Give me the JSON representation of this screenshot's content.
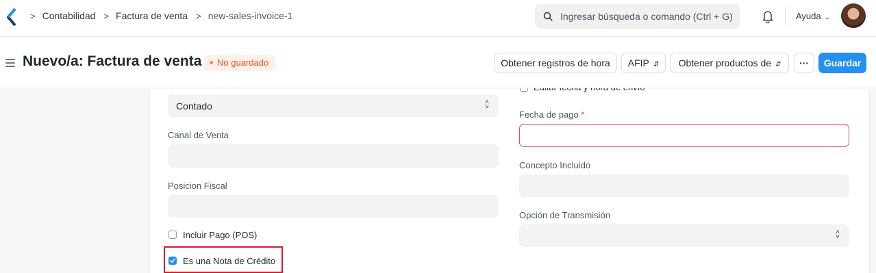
{
  "navbar": {
    "breadcrumbs": [
      "Contabilidad",
      "Factura de venta",
      "new-sales-invoice-1"
    ],
    "search_placeholder": "Ingresar búsqueda o comando (Ctrl + G)",
    "help_label": "Ayuda"
  },
  "page_header": {
    "title": "Nuevo/a: Factura de venta",
    "status": "No guardado",
    "buttons": {
      "time_logs": "Obtener registros de hora",
      "afip": "AFIP",
      "get_items": "Obtener productos de",
      "more": "···",
      "save": "Guardar"
    }
  },
  "form": {
    "left": {
      "payment_type_value": "Contado",
      "sales_channel_label": "Canal de Venta",
      "sales_channel_value": "",
      "fiscal_position_label": "Posicion Fiscal",
      "fiscal_position_value": "",
      "include_payment_label": "Incluir Pago (POS)",
      "include_payment_checked": false,
      "credit_note_label": "Es una Nota de Crédito",
      "credit_note_checked": true
    },
    "right": {
      "edit_datetime_label": "Editar fecha y hora de envío",
      "edit_datetime_checked": false,
      "due_date_label": "Fecha de pago",
      "due_date_required_mark": "*",
      "due_date_value": "",
      "concept_label": "Concepto Incluido",
      "concept_value": "",
      "transmission_label": "Opción de Transmisión",
      "transmission_value": ""
    }
  },
  "colors": {
    "primary": "#2490ef",
    "status_text": "#e8562e",
    "status_bg": "#fff1ea",
    "error_border": "#e24c4c",
    "highlight": "#d9192b"
  }
}
